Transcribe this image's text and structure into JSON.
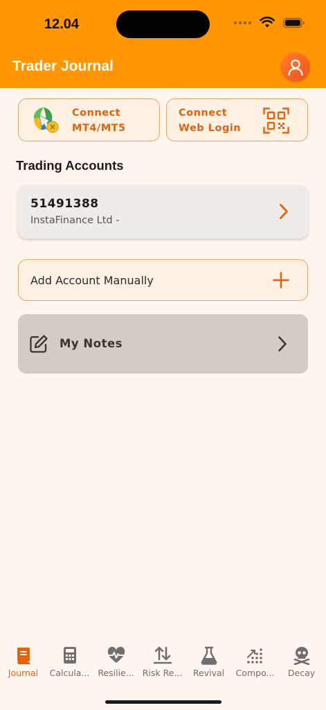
{
  "status_bar": {
    "time": "12.04"
  },
  "header": {
    "title": "Trader Journal"
  },
  "connect": {
    "mt": {
      "line1": "Connect",
      "line2": "MT4/MT5"
    },
    "web": {
      "line1": "Connect",
      "line2": "Web Login"
    }
  },
  "accounts": {
    "section_title": "Trading Accounts",
    "items": [
      {
        "number": "51491388",
        "broker": "InstaFinance Ltd -"
      }
    ]
  },
  "add_account": {
    "label": "Add Account Manually"
  },
  "notes": {
    "label": "My Notes"
  },
  "tabs": [
    {
      "label": "Journal",
      "icon": "book-icon",
      "active": true
    },
    {
      "label": "Calcula...",
      "icon": "calculator-icon",
      "active": false
    },
    {
      "label": "Resilie...",
      "icon": "heartbeat-icon",
      "active": false
    },
    {
      "label": "Risk Re...",
      "icon": "arrows-icon",
      "active": false
    },
    {
      "label": "Revival",
      "icon": "flask-icon",
      "active": false
    },
    {
      "label": "Compo...",
      "icon": "dots-grid-icon",
      "active": false
    },
    {
      "label": "Decay",
      "icon": "skull-icon",
      "active": false
    }
  ],
  "colors": {
    "accent": "#ff9602",
    "accent_text": "#e2620f",
    "background": "#fff6ef"
  }
}
